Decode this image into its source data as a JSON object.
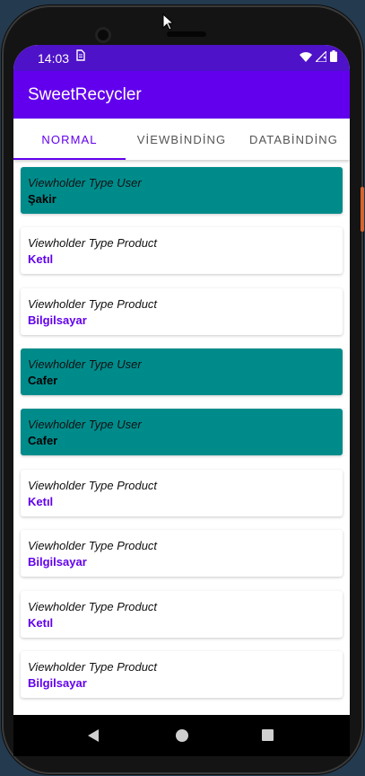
{
  "status_bar": {
    "time": "14:03",
    "sim_icon": "sim-icon",
    "wifi_icon": "wifi-icon",
    "signal_icon": "signal-icon",
    "battery_icon": "battery-icon"
  },
  "app_bar": {
    "title": "SweetRecycler"
  },
  "tabs": [
    {
      "label": "NORMAL",
      "active": true
    },
    {
      "label": "VİEWBİNDİNG",
      "active": false
    },
    {
      "label": "DATABİNDİNG",
      "active": false
    }
  ],
  "list": [
    {
      "kind": "user",
      "type_label": "Viewholder Type User",
      "name": "Şakir"
    },
    {
      "kind": "product",
      "type_label": "Viewholder Type Product",
      "name": "Ketıl"
    },
    {
      "kind": "product",
      "type_label": "Viewholder Type Product",
      "name": "Bilgilsayar"
    },
    {
      "kind": "user",
      "type_label": "Viewholder Type User",
      "name": "Cafer"
    },
    {
      "kind": "user",
      "type_label": "Viewholder Type User",
      "name": "Cafer"
    },
    {
      "kind": "product",
      "type_label": "Viewholder Type Product",
      "name": "Ketıl"
    },
    {
      "kind": "product",
      "type_label": "Viewholder Type Product",
      "name": "Bilgilsayar"
    },
    {
      "kind": "product",
      "type_label": "Viewholder Type Product",
      "name": "Ketıl"
    },
    {
      "kind": "product",
      "type_label": "Viewholder Type Product",
      "name": "Bilgilsayar"
    }
  ],
  "colors": {
    "primary": "#6200ee",
    "status_bar": "#4e12c8",
    "user_card": "#008b8b"
  },
  "nav_bar": {
    "back_icon": "back-triangle-icon",
    "home_icon": "home-circle-icon",
    "recents_icon": "recents-square-icon"
  }
}
